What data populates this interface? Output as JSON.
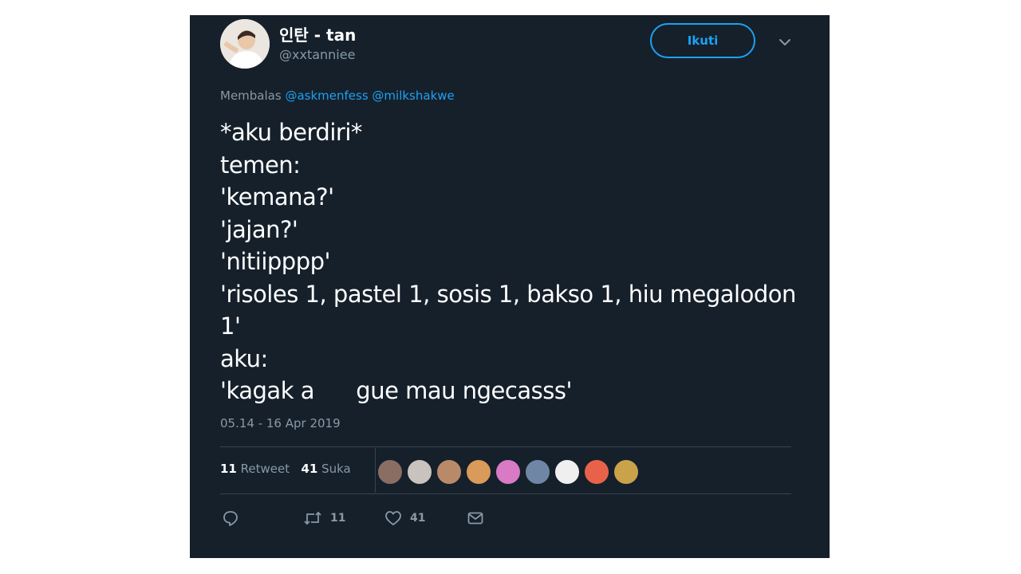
{
  "tweet": {
    "user": {
      "display_name": "인탄 - tan",
      "handle": "@xxtanniee"
    },
    "follow_label": "Ikuti",
    "reply_prefix": "Membalas",
    "reply_mentions": [
      "@askmenfess",
      "@milkshakwe"
    ],
    "text": "*aku berdiri*\ntemen:\n'kemana?'\n'jajan?'\n'nitiipppp'\n'risoles 1, pastel 1, sosis 1, bakso 1, hiu megalodon 1'\naku:\n'kagak a      gue mau ngecasss'",
    "timestamp": "05.14 - 16 Apr 2019",
    "stats": {
      "retweets_count": "11",
      "retweets_label": "Retweet",
      "likes_count": "41",
      "likes_label": "Suka"
    },
    "actions": {
      "reply_icon": "reply-icon",
      "retweet_icon": "retweet-icon",
      "retweet_count": "11",
      "like_icon": "heart-icon",
      "like_count": "41",
      "dm_icon": "mail-icon"
    },
    "liker_colors": [
      "#8a6e64",
      "#c9c3bd",
      "#b88a6a",
      "#d99a5a",
      "#d87ac4",
      "#6f86a4",
      "#efefef",
      "#e8624a",
      "#c9a24a"
    ]
  },
  "colors": {
    "background": "#15202b",
    "accent": "#1da1f2",
    "secondary_text": "#8899a6"
  }
}
